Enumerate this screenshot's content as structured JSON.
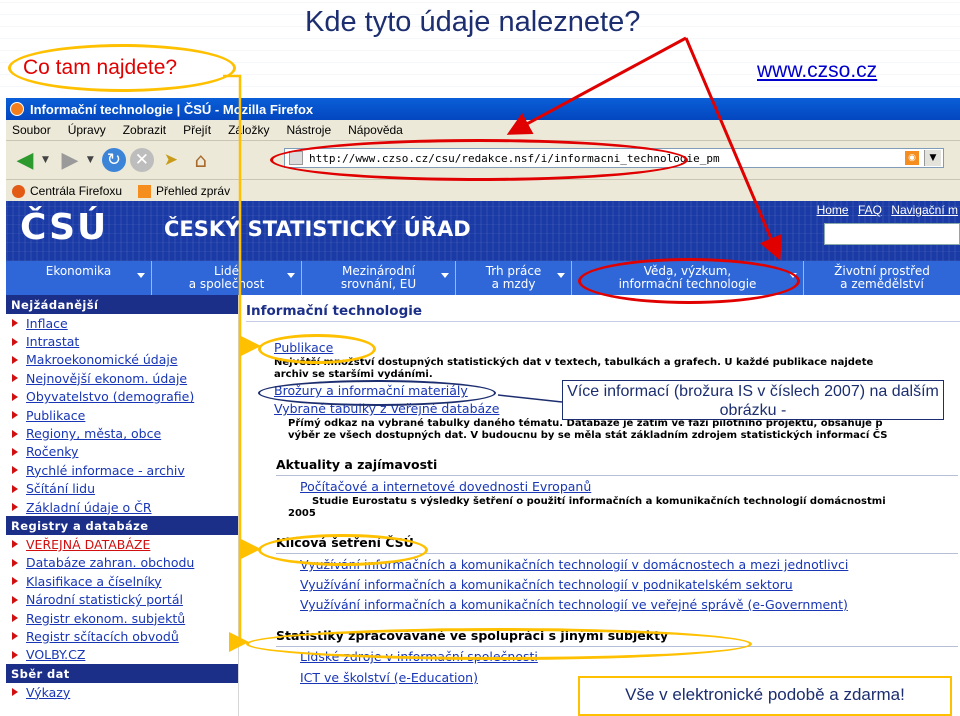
{
  "slide": {
    "title": "Kde tyto údaje naleznete?",
    "callout_left": "Co tam najdete?",
    "website": "www.czso.cz",
    "callout_more": "Více informací (brožura IS v číslech 2007) na dalším obrázku -",
    "callout_free": "Vše v elektronické podobě a zdarma!",
    "colors": {
      "accent_red": "#e00000",
      "accent_yellow": "#ffc000",
      "title_blue": "#1c2e6f"
    }
  },
  "browser": {
    "window_title": "Informační technologie | ČSÚ - Mozilla Firefox",
    "menu": [
      "Soubor",
      "Úpravy",
      "Zobrazit",
      "Přejít",
      "Záložky",
      "Nástroje",
      "Nápověda"
    ],
    "url": "http://www.czso.cz/csu/redakce.nsf/i/informacni_technologie_pm",
    "bookmarks": [
      "Centrála Firefoxu",
      "Přehled zpráv"
    ],
    "icons": [
      "back-icon",
      "forward-icon",
      "reload-icon",
      "stop-icon",
      "go-icon",
      "home-icon",
      "rss-icon"
    ]
  },
  "site": {
    "logo": "ČSÚ",
    "fullname": "ČESKÝ STATISTICKÝ ÚŘAD",
    "top_links": [
      "Home",
      "FAQ",
      "Navigační m"
    ],
    "nav": [
      {
        "line1": "Ekonomika",
        "line2": ""
      },
      {
        "line1": "Lidé",
        "line2": "a společnost"
      },
      {
        "line1": "Mezinárodní",
        "line2": "srovnání, EU"
      },
      {
        "line1": "Trh práce",
        "line2": "a mzdy"
      },
      {
        "line1": "Věda, výzkum,",
        "line2": "informační technologie"
      },
      {
        "line1": "Životní prostřed",
        "line2": "a zemědělství"
      }
    ],
    "sidebar": {
      "head1": "Nejžádanější",
      "items1": [
        "Inflace",
        "Intrastat",
        "Makroekonomické údaje",
        "Nejnovější ekonom. údaje",
        "Obyvatelstvo (demografie)",
        "Publikace",
        "Regiony, města, obce",
        "Ročenky",
        "Rychlé informace - archiv",
        "Sčítání lidu",
        "Základní údaje o ČR"
      ],
      "head2": "Registry a databáze",
      "items2": [
        "VEŘEJNÁ DATABÁZE",
        "Databáze zahran. obchodu",
        "Klasifikace a číselníky",
        "Národní statistický portál",
        "Registr ekonom. subjektů",
        "Registr sčítacích obvodů",
        "VOLBY.CZ"
      ],
      "head3": "Sběr dat",
      "items3": [
        "Výkazy"
      ]
    },
    "main": {
      "title": "Informační technologie",
      "publikace": "Publikace",
      "publikace_desc1": "Největší množství dostupných statistických dat v textech, tabulkách a grafech. U každé publikace najdete",
      "publikace_desc2": "archiv se staršími vydáními.",
      "brozury": "Brožury a informační materiály",
      "tabulky": "Vybrané tabulky z Veřejné databáze",
      "tabulky_desc1": "Přímý odkaz na vybrané tabulky daného tématu. Databáze je zatím ve fázi pilotního projektu, obsahuje p",
      "tabulky_desc2": "výběr ze všech dostupných dat. V budoucnu by se měla stát základním zdrojem statistických informací ČS",
      "aktuality_head": "Aktuality a zajímavosti",
      "aktuality_link": "Počítačové a internetové dovednosti Evropanů",
      "aktuality_desc1": "Studie Eurostatu s výsledky šetření o použití informačních a komunikačních technologií domácnostmi",
      "aktuality_desc2": "2005",
      "klicova_head": "Klíčová šetření ČSÚ",
      "klicova_links": [
        "Využívání informačních a komunikačních technologií v domácnostech a mezi jednotlivci",
        "Využívání informačních a komunikačních technologií v podnikatelském sektoru",
        "Využívání informačních a komunikačních technologií ve veřejné správě (e-Government)"
      ],
      "statistiky_head": "Statistiky zpracovávané ve spolupráci s jinými subjekty",
      "statistiky_links": [
        "Lidské zdroje v informační společnosti",
        "ICT ve školství (e-Education)"
      ]
    }
  }
}
